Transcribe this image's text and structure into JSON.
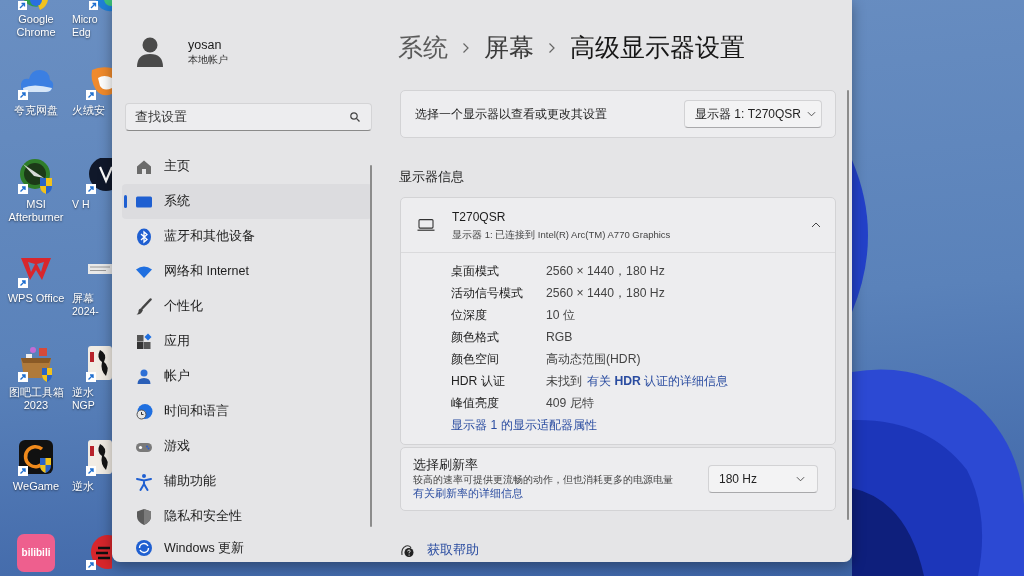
{
  "desktop": {
    "shortcuts": [
      {
        "lines": [
          "Google",
          "Chrome"
        ]
      },
      {
        "lines": [
          "夸克网盘"
        ]
      },
      {
        "lines": [
          "MSI",
          "Afterburner"
        ]
      },
      {
        "lines": [
          "WPS Office"
        ]
      },
      {
        "lines": [
          "图吧工具箱",
          "2023"
        ]
      },
      {
        "lines": [
          "WeGame"
        ]
      },
      {
        "logo_text": "bilibili"
      }
    ],
    "shortcuts_column_2": [
      {
        "lines": [
          "Micro",
          "Edg"
        ]
      },
      {
        "lines": [
          "火绒安"
        ]
      },
      {
        "lines": [
          "V H"
        ]
      },
      {
        "lines": [
          "屏幕",
          "2024-"
        ]
      },
      {
        "lines": [
          "逆水",
          "NGP"
        ]
      },
      {
        "lines": [
          "逆水"
        ]
      }
    ]
  },
  "window": {
    "account": {
      "name": "yosan",
      "type": "本地帐户"
    },
    "search": {
      "placeholder": "查找设置"
    },
    "nav": [
      {
        "label": "主页",
        "selected": false
      },
      {
        "label": "系统",
        "selected": true
      },
      {
        "label": "蓝牙和其他设备",
        "selected": false
      },
      {
        "label": "网络和 Internet",
        "selected": false
      },
      {
        "label": "个性化",
        "selected": false
      },
      {
        "label": "应用",
        "selected": false
      },
      {
        "label": "帐户",
        "selected": false
      },
      {
        "label": "时间和语言",
        "selected": false
      },
      {
        "label": "游戏",
        "selected": false
      },
      {
        "label": "辅助功能",
        "selected": false
      },
      {
        "label": "隐私和安全性",
        "selected": false
      },
      {
        "label": "Windows 更新",
        "selected": false
      }
    ],
    "breadcrumb": [
      "系统",
      "屏幕",
      "高级显示器设置"
    ],
    "display_picker": {
      "label": "选择一个显示器以查看或更改其设置",
      "value": "显示器 1: T270QSR"
    },
    "section_title": "显示器信息",
    "monitor": {
      "name": "T270QSR",
      "subtitle": "显示器 1: 已连接到 Intel(R) Arc(TM) A770 Graphics",
      "expanded": true,
      "rows": [
        {
          "label": "桌面模式",
          "value": "2560 × 1440，180 Hz"
        },
        {
          "label": "活动信号模式",
          "value": "2560 × 1440，180 Hz"
        },
        {
          "label": "位深度",
          "value": "10 位"
        },
        {
          "label": "颜色格式",
          "value": "RGB"
        },
        {
          "label": "颜色空间",
          "value": "高动态范围(HDR)"
        },
        {
          "label": "HDR 认证",
          "value": "未找到",
          "link": "有关 **HDR** 认证的详细信息"
        },
        {
          "label": "峰值亮度",
          "value": "409 尼特"
        }
      ],
      "adapter_link": "显示器 1 的显示适配器属性"
    },
    "refresh_rate": {
      "title": "选择刷新率",
      "description": "较高的速率可提供更流畅的动作，但也消耗更多的电源电量",
      "link": "有关刷新率的详细信息",
      "value": "180 Hz"
    },
    "help_link": "获取帮助"
  }
}
